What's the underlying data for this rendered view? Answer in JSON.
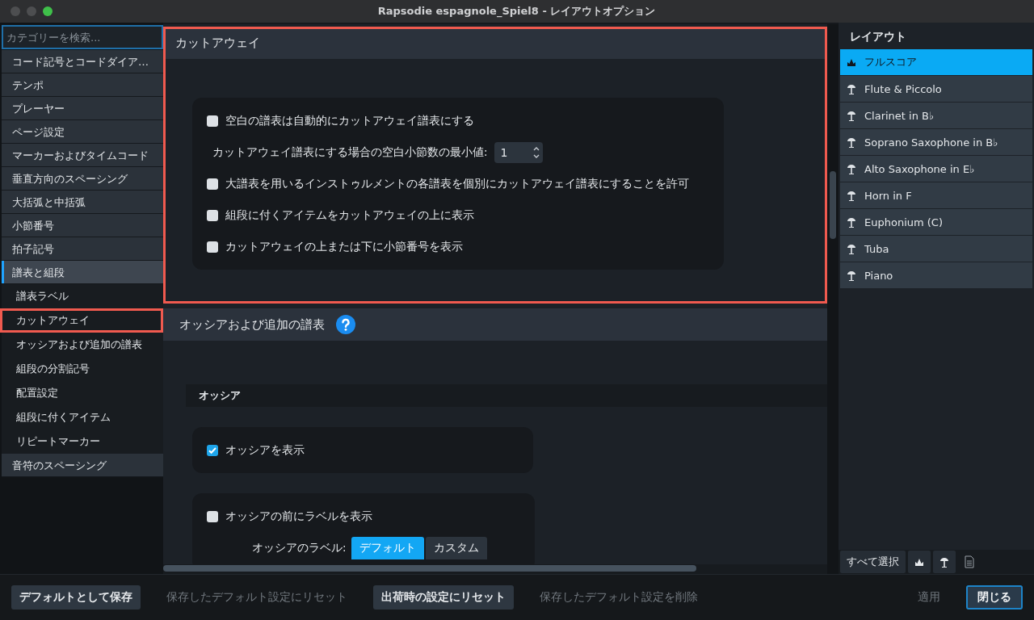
{
  "window": {
    "title": "Rapsodie espagnole_Spiel8 - レイアウトオプション"
  },
  "sidebar": {
    "search": {
      "placeholder": "カテゴリーを検索..."
    },
    "items": [
      {
        "label": "コード記号とコードダイア…",
        "kind": "category",
        "selected": false,
        "highlighted": false
      },
      {
        "label": "テンポ",
        "kind": "category",
        "selected": false,
        "highlighted": false
      },
      {
        "label": "プレーヤー",
        "kind": "category",
        "selected": false,
        "highlighted": false
      },
      {
        "label": "ページ設定",
        "kind": "category",
        "selected": false,
        "highlighted": false
      },
      {
        "label": "マーカーおよびタイムコード",
        "kind": "category",
        "selected": false,
        "highlighted": false
      },
      {
        "label": "垂直方向のスペーシング",
        "kind": "category",
        "selected": false,
        "highlighted": false
      },
      {
        "label": "大括弧と中括弧",
        "kind": "category",
        "selected": false,
        "highlighted": false
      },
      {
        "label": "小節番号",
        "kind": "category",
        "selected": false,
        "highlighted": false
      },
      {
        "label": "拍子記号",
        "kind": "category",
        "selected": false,
        "highlighted": false
      },
      {
        "label": "譜表と組段",
        "kind": "category",
        "selected": true,
        "highlighted": false
      },
      {
        "label": "譜表ラベル",
        "kind": "sub",
        "selected": false,
        "highlighted": false
      },
      {
        "label": "カットアウェイ",
        "kind": "sub",
        "selected": false,
        "highlighted": true
      },
      {
        "label": "オッシアおよび追加の譜表",
        "kind": "sub",
        "selected": false,
        "highlighted": false
      },
      {
        "label": "組段の分割記号",
        "kind": "sub",
        "selected": false,
        "highlighted": false
      },
      {
        "label": "配置設定",
        "kind": "sub",
        "selected": false,
        "highlighted": false
      },
      {
        "label": "組段に付くアイテム",
        "kind": "sub",
        "selected": false,
        "highlighted": false
      },
      {
        "label": "リピートマーカー",
        "kind": "sub",
        "selected": false,
        "highlighted": false
      },
      {
        "label": "音符のスペーシング",
        "kind": "category",
        "selected": false,
        "highlighted": false
      }
    ]
  },
  "sections": [
    {
      "title": "カットアウェイ",
      "help": false,
      "highlighted": true,
      "blocks": [
        {
          "kind": "card",
          "rows": [
            {
              "kind": "checkbox",
              "label": "空白の譜表は自動的にカットアウェイ譜表にする",
              "checked": false
            },
            {
              "kind": "number",
              "label": "カットアウェイ譜表にする場合の空白小節数の最小値:",
              "value": "1"
            },
            {
              "kind": "checkbox",
              "label": "大譜表を用いるインストゥルメントの各譜表を個別にカットアウェイ譜表にすることを許可",
              "checked": false
            },
            {
              "kind": "checkbox",
              "label": "組段に付くアイテムをカットアウェイの上に表示",
              "checked": false
            },
            {
              "kind": "checkbox",
              "label": "カットアウェイの上または下に小節番号を表示",
              "checked": false
            }
          ]
        }
      ]
    },
    {
      "title": "オッシアおよび追加の譜表",
      "help": true,
      "highlighted": false,
      "blocks": [
        {
          "kind": "subheading",
          "title": "オッシア"
        },
        {
          "kind": "card",
          "rows": [
            {
              "kind": "checkbox",
              "label": "オッシアを表示",
              "checked": true
            }
          ]
        },
        {
          "kind": "card",
          "rows": [
            {
              "kind": "checkbox",
              "label": "オッシアの前にラベルを表示",
              "checked": false
            },
            {
              "kind": "segmented",
              "label": "オッシアのラベル:",
              "options": [
                {
                  "label": "デフォルト",
                  "selected": true
                },
                {
                  "label": "カスタム",
                  "selected": false
                }
              ]
            }
          ]
        }
      ]
    }
  ],
  "layouts": {
    "title": "レイアウト",
    "items": [
      {
        "label": "フルスコア",
        "kind": "full",
        "selected": true
      },
      {
        "label": "Flute & Piccolo",
        "kind": "part",
        "selected": false
      },
      {
        "label": "Clarinet  in B♭",
        "kind": "part",
        "selected": false
      },
      {
        "label": "Soprano Saxophone in B♭",
        "kind": "part",
        "selected": false
      },
      {
        "label": "Alto Saxophone in E♭",
        "kind": "part",
        "selected": false
      },
      {
        "label": "Horn in F",
        "kind": "part",
        "selected": false
      },
      {
        "label": "Euphonium (C)",
        "kind": "part",
        "selected": false
      },
      {
        "label": "Tuba",
        "kind": "part",
        "selected": false
      },
      {
        "label": "Piano",
        "kind": "part",
        "selected": false
      }
    ],
    "select_all": "すべて選択"
  },
  "footer": [
    {
      "label": "デフォルトとして保存",
      "kind": "filled",
      "disabled": false
    },
    {
      "label": "保存したデフォルト設定にリセット",
      "kind": "flat",
      "disabled": true
    },
    {
      "label": "出荷時の設定にリセット",
      "kind": "filled",
      "disabled": false
    },
    {
      "label": "保存したデフォルト設定を削除",
      "kind": "flat",
      "disabled": true
    },
    {
      "label": "適用",
      "kind": "flat",
      "disabled": true
    },
    {
      "label": "閉じる",
      "kind": "primary",
      "disabled": false
    }
  ]
}
